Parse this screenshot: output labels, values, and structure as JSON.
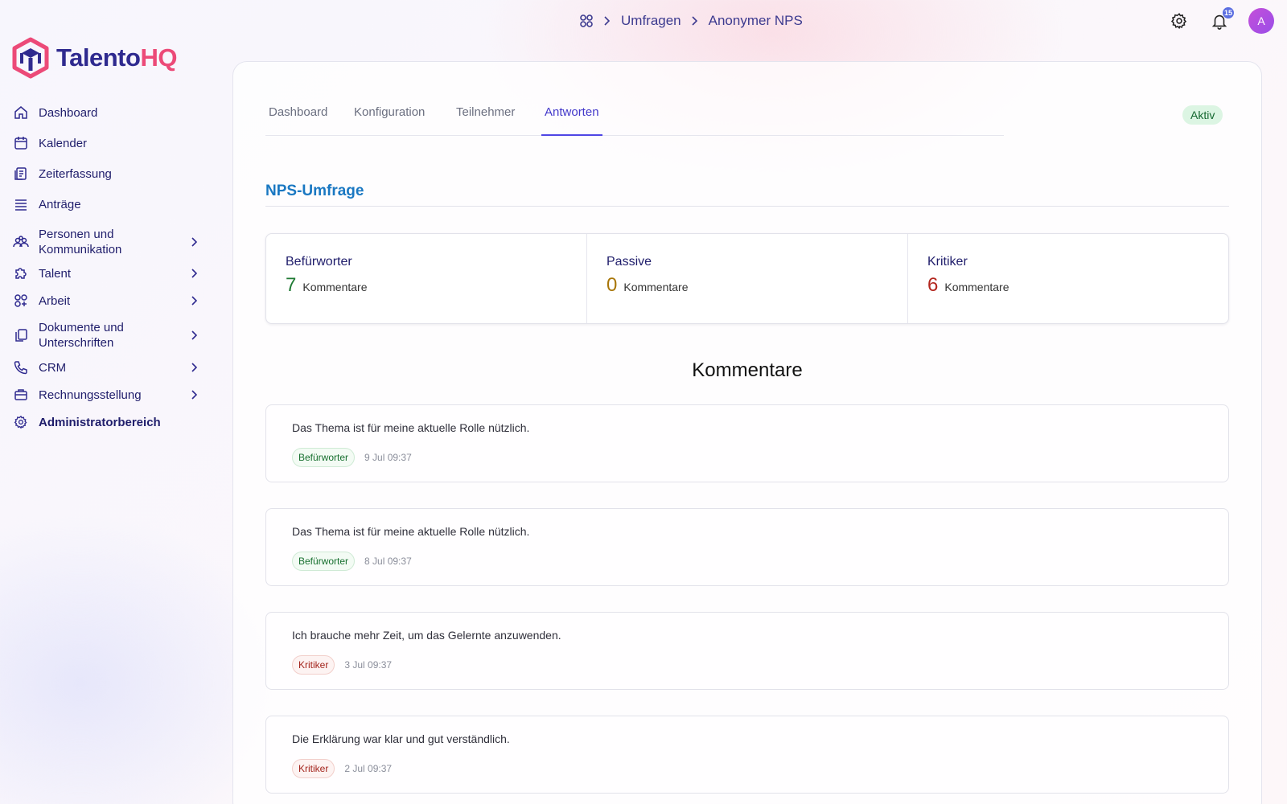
{
  "breadcrumb": {
    "items": [
      "Umfragen",
      "Anonymer NPS"
    ]
  },
  "topbar": {
    "notification_count": "15",
    "avatar_initial": "A"
  },
  "brand": {
    "name_part1": "Talento",
    "name_part2": "HQ",
    "colors": {
      "primary": "#2f2a8f",
      "accent": "#ec4a78"
    }
  },
  "sidebar": {
    "items": [
      {
        "label": "Dashboard",
        "icon": "home-icon"
      },
      {
        "label": "Kalender",
        "icon": "calendar-icon"
      },
      {
        "label": "Zeiterfassung",
        "icon": "clipboard-icon"
      },
      {
        "label": "Anträge",
        "icon": "list-icon"
      },
      {
        "label": "Personen und Kommunikation",
        "icon": "people-icon",
        "expandable": true
      },
      {
        "label": "Talent",
        "icon": "puzzle-icon",
        "expandable": true
      },
      {
        "label": "Arbeit",
        "icon": "grid-icon",
        "expandable": true
      },
      {
        "label": "Dokumente und Unterschriften",
        "icon": "documents-icon",
        "expandable": true
      },
      {
        "label": "CRM",
        "icon": "phone-icon",
        "expandable": true
      },
      {
        "label": "Rechnungsstellung",
        "icon": "briefcase-icon",
        "expandable": true
      },
      {
        "label": "Administratorbereich",
        "icon": "gear-icon"
      }
    ]
  },
  "tabs": [
    {
      "label": "Dashboard",
      "active": false
    },
    {
      "label": "Konfiguration",
      "active": false
    },
    {
      "label": "Teilnehmer",
      "active": false
    },
    {
      "label": "Antworten",
      "active": true
    }
  ],
  "status": "Aktiv",
  "section_title": "NPS-Umfrage",
  "stats": [
    {
      "label": "Befürworter",
      "count": "7",
      "unit": "Kommentare",
      "color": "#1f7a33"
    },
    {
      "label": "Passive",
      "count": "0",
      "unit": "Kommentare",
      "color": "#a87608"
    },
    {
      "label": "Kritiker",
      "count": "6",
      "unit": "Kommentare",
      "color": "#b3261e"
    }
  ],
  "comments_heading": "Kommentare",
  "comments": [
    {
      "text": "Das Thema ist für meine aktuelle Rolle nützlich.",
      "tag": "Befürworter",
      "date": "9 Jul 09:37"
    },
    {
      "text": "Das Thema ist für meine aktuelle Rolle nützlich.",
      "tag": "Befürworter",
      "date": "8 Jul 09:37"
    },
    {
      "text": "Ich brauche mehr Zeit, um das Gelernte anzuwenden.",
      "tag": "Kritiker",
      "date": "3 Jul 09:37"
    },
    {
      "text": "Die Erklärung war klar und gut verständlich.",
      "tag": "Kritiker",
      "date": "2 Jul 09:37"
    }
  ]
}
